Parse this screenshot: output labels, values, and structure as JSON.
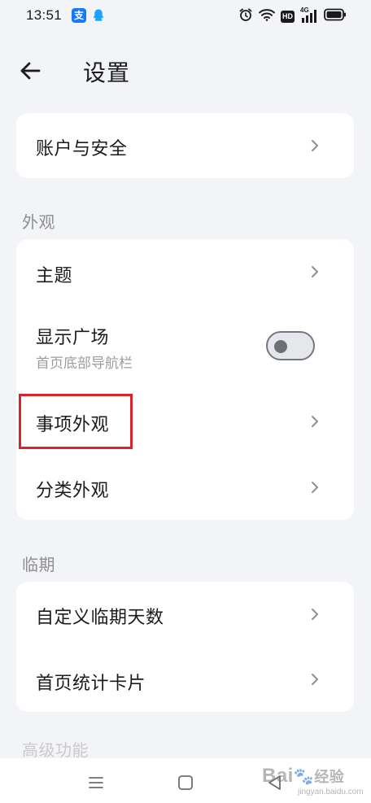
{
  "status_bar": {
    "time": "13:51",
    "alipay_glyph": "支",
    "network_label": "4G",
    "hd_label": "HD",
    "icons": [
      "alipay-icon",
      "qq-icon",
      "alarm-icon",
      "wifi-icon",
      "hd-icon",
      "signal-4g-icon",
      "battery-icon"
    ]
  },
  "header": {
    "title": "设置",
    "back_icon": "arrow-left-icon"
  },
  "account_card": {
    "item_label": "账户与安全"
  },
  "appearance": {
    "section_title": "外观",
    "theme_label": "主题",
    "show_plaza_label": "显示广场",
    "show_plaza_sublabel": "首页底部导航栏",
    "show_plaza_enabled": false,
    "item_appearance_label": "事项外观",
    "category_appearance_label": "分类外观"
  },
  "due": {
    "section_title": "临期",
    "custom_days_label": "自定义临期天数",
    "home_stats_card_label": "首页统计卡片"
  },
  "faded_next_section": "高级功能",
  "nav_bar": {
    "icons": [
      "menu-icon",
      "home-square-icon",
      "back-triangle-icon"
    ]
  },
  "watermark": {
    "text": "Bai",
    "text_after": "经验",
    "sub": "jingyan.baidu.com"
  },
  "colors": {
    "background": "#f3f4f8",
    "card": "#ffffff",
    "highlight": "#d8242b",
    "secondary_text": "#9c9ca2"
  }
}
